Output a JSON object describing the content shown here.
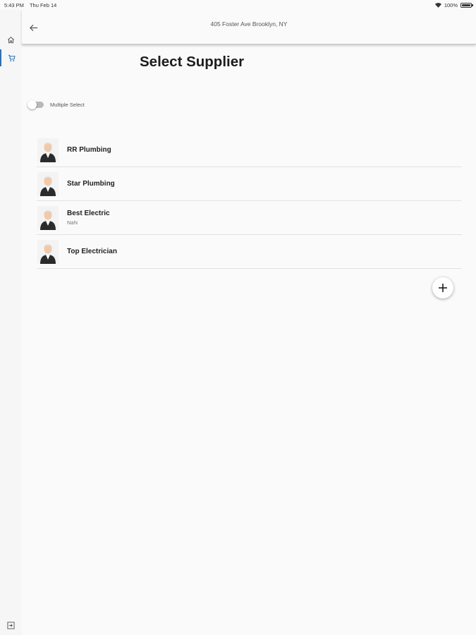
{
  "status_bar": {
    "time": "5:43 PM",
    "date": "Thu Feb 14",
    "battery": "100%"
  },
  "header": {
    "address": "405 Foster Ave Brooklyn, NY"
  },
  "page": {
    "title": "Select Supplier"
  },
  "multiple_select": {
    "label": "Multiple Select",
    "enabled": false
  },
  "suppliers": [
    {
      "name": "RR Plumbing",
      "subtitle": ""
    },
    {
      "name": "Star Plumbing",
      "subtitle": ""
    },
    {
      "name": "Best Electric",
      "subtitle": "NaN"
    },
    {
      "name": "Top Electrician",
      "subtitle": ""
    }
  ],
  "icons": {
    "rail_home": "home-icon",
    "rail_cart": "cart-icon",
    "back": "arrow-left-icon",
    "add": "plus-icon",
    "logout": "logout-icon",
    "avatar": "person-avatar-icon"
  },
  "colors": {
    "accent": "#1976d2"
  }
}
